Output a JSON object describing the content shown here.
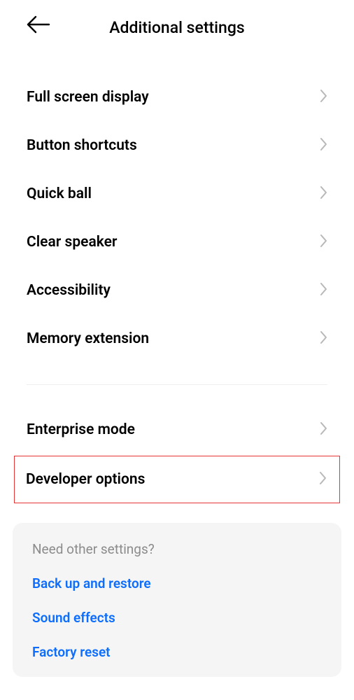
{
  "header": {
    "title": "Additional settings"
  },
  "items_group1": [
    {
      "label": "Full screen display"
    },
    {
      "label": "Button shortcuts"
    },
    {
      "label": "Quick ball"
    },
    {
      "label": "Clear speaker"
    },
    {
      "label": "Accessibility"
    },
    {
      "label": "Memory extension"
    }
  ],
  "items_group2": [
    {
      "label": "Enterprise mode"
    }
  ],
  "highlighted_item": {
    "label": "Developer options"
  },
  "suggestions": {
    "title": "Need other settings?",
    "links": [
      {
        "label": "Back up and restore"
      },
      {
        "label": "Sound effects"
      },
      {
        "label": "Factory reset"
      }
    ]
  }
}
